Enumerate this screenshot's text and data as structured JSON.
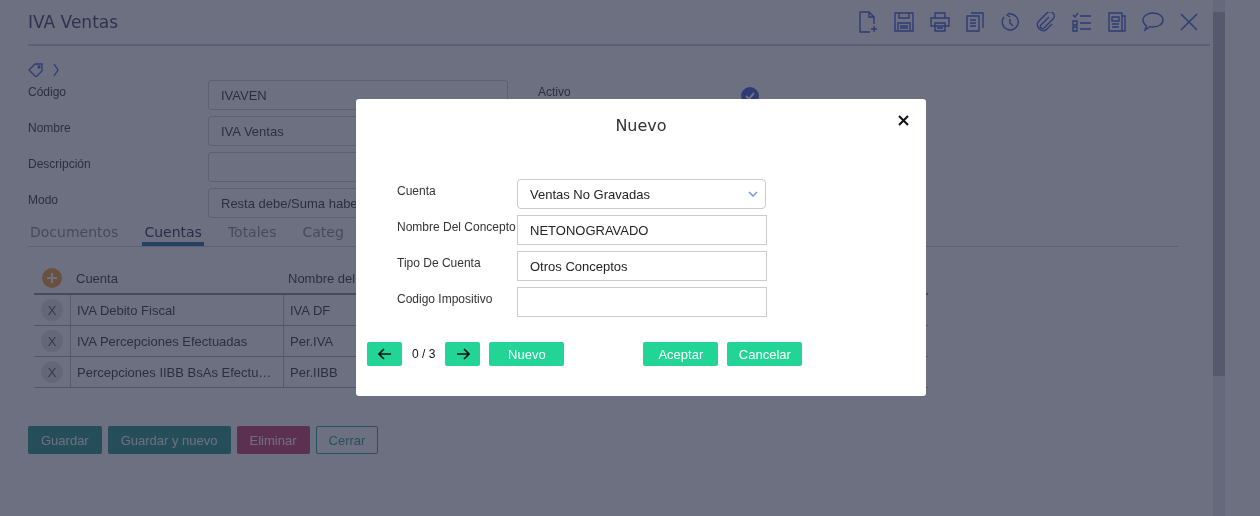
{
  "page": {
    "title": "IVA Ventas",
    "fields": [
      {
        "label": "Código",
        "value": "IVAVEN"
      },
      {
        "label": "Nombre",
        "value": "IVA Ventas"
      },
      {
        "label": "Descripción"
      },
      {
        "label": "Modo",
        "value": "Resta debe/Suma habe"
      }
    ],
    "side_label": "Activo",
    "tabs": [
      {
        "label": "Documentos",
        "selected": false
      },
      {
        "label": "Cuentas",
        "selected": true
      },
      {
        "label": "Totales",
        "selected": false
      },
      {
        "label": "Categ",
        "selected": false
      }
    ],
    "table": {
      "columns": [
        "Cuenta",
        "Nombre del"
      ],
      "rows": [
        {
          "delete": "X",
          "cells": [
            "IVA Debito Fiscal",
            "IVA DF"
          ]
        },
        {
          "delete": "X",
          "cells": [
            "IVA Percepciones Efectuadas",
            "Per.IVA"
          ]
        },
        {
          "delete": "X",
          "cells": [
            "Percepciones IIBB BsAs Efectu…",
            "Per.IIBB"
          ]
        }
      ]
    },
    "buttons": [
      {
        "label": "Guardar",
        "kind": "primary"
      },
      {
        "label": "Guardar y nuevo",
        "kind": "primary"
      },
      {
        "label": "Eliminar",
        "kind": "danger"
      },
      {
        "label": "Cerrar",
        "kind": "outline"
      }
    ]
  },
  "dialog": {
    "title": "Nuevo",
    "fields": [
      {
        "label": "Cuenta",
        "value": "Ventas No Gravadas",
        "kind": "select"
      },
      {
        "label": "Nombre Del Concepto",
        "value": "NETONOGRAVADO",
        "kind": "text"
      },
      {
        "label": "Tipo De Cuenta",
        "value": "Otros Conceptos",
        "kind": "text"
      },
      {
        "label": "Codigo Impositivo",
        "kind": "text"
      }
    ],
    "counter": "0 / 3",
    "new_button": "Nuevo",
    "buttons": [
      "Aceptar",
      "Cancelar"
    ]
  }
}
